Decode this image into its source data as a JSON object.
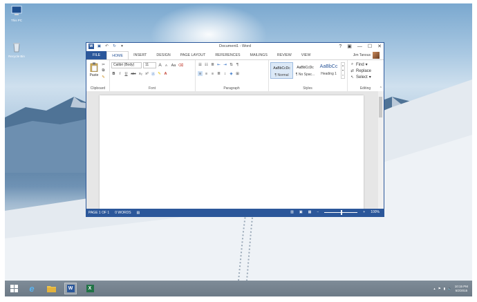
{
  "desktop": {
    "icons": [
      {
        "label": "This PC",
        "icon": "this-pc-icon"
      },
      {
        "label": "Recycle Bin",
        "icon": "recycle-bin-icon"
      }
    ]
  },
  "window": {
    "title": "Document1 - Word",
    "controls": {
      "help": "?",
      "ribbon_display": "▣",
      "minimize": "—",
      "maximize": "☐",
      "close": "✕"
    },
    "user_name": "Jim Tanous"
  },
  "tabs": [
    {
      "label": "FILE"
    },
    {
      "label": "HOME"
    },
    {
      "label": "INSERT"
    },
    {
      "label": "DESIGN"
    },
    {
      "label": "PAGE LAYOUT"
    },
    {
      "label": "REFERENCES"
    },
    {
      "label": "MAILINGS"
    },
    {
      "label": "REVIEW"
    },
    {
      "label": "VIEW"
    }
  ],
  "ribbon": {
    "clipboard": {
      "paste": "Paste",
      "label": "Clipboard"
    },
    "font": {
      "family": "Calibri (Body)",
      "size": "11",
      "label": "Font",
      "bold": "B",
      "italic": "I",
      "underline": "U",
      "strike": "abc",
      "sub": "x₂",
      "sup": "x²",
      "grow": "A",
      "shrink": "A",
      "case": "Aa"
    },
    "paragraph": {
      "label": "Paragraph",
      "pilcrow": "¶"
    },
    "styles": {
      "label": "Styles",
      "items": [
        {
          "sample": "AaBbCcDc",
          "name": "¶ Normal"
        },
        {
          "sample": "AaBbCcDc",
          "name": "¶ No Spac..."
        },
        {
          "sample": "AaBbCc",
          "name": "Heading 1"
        }
      ]
    },
    "editing": {
      "label": "Editing",
      "find": "Find",
      "replace": "Replace",
      "select": "Select"
    }
  },
  "status": {
    "page": "PAGE 1 OF 1",
    "words": "0 WORDS",
    "zoom": "100%",
    "zoom_minus": "−",
    "zoom_plus": "+"
  },
  "taskbar": {
    "time": "10:15 PM",
    "date": "5/2/2015"
  },
  "colors": {
    "word_blue": "#2b579a",
    "excel_green": "#217346"
  }
}
